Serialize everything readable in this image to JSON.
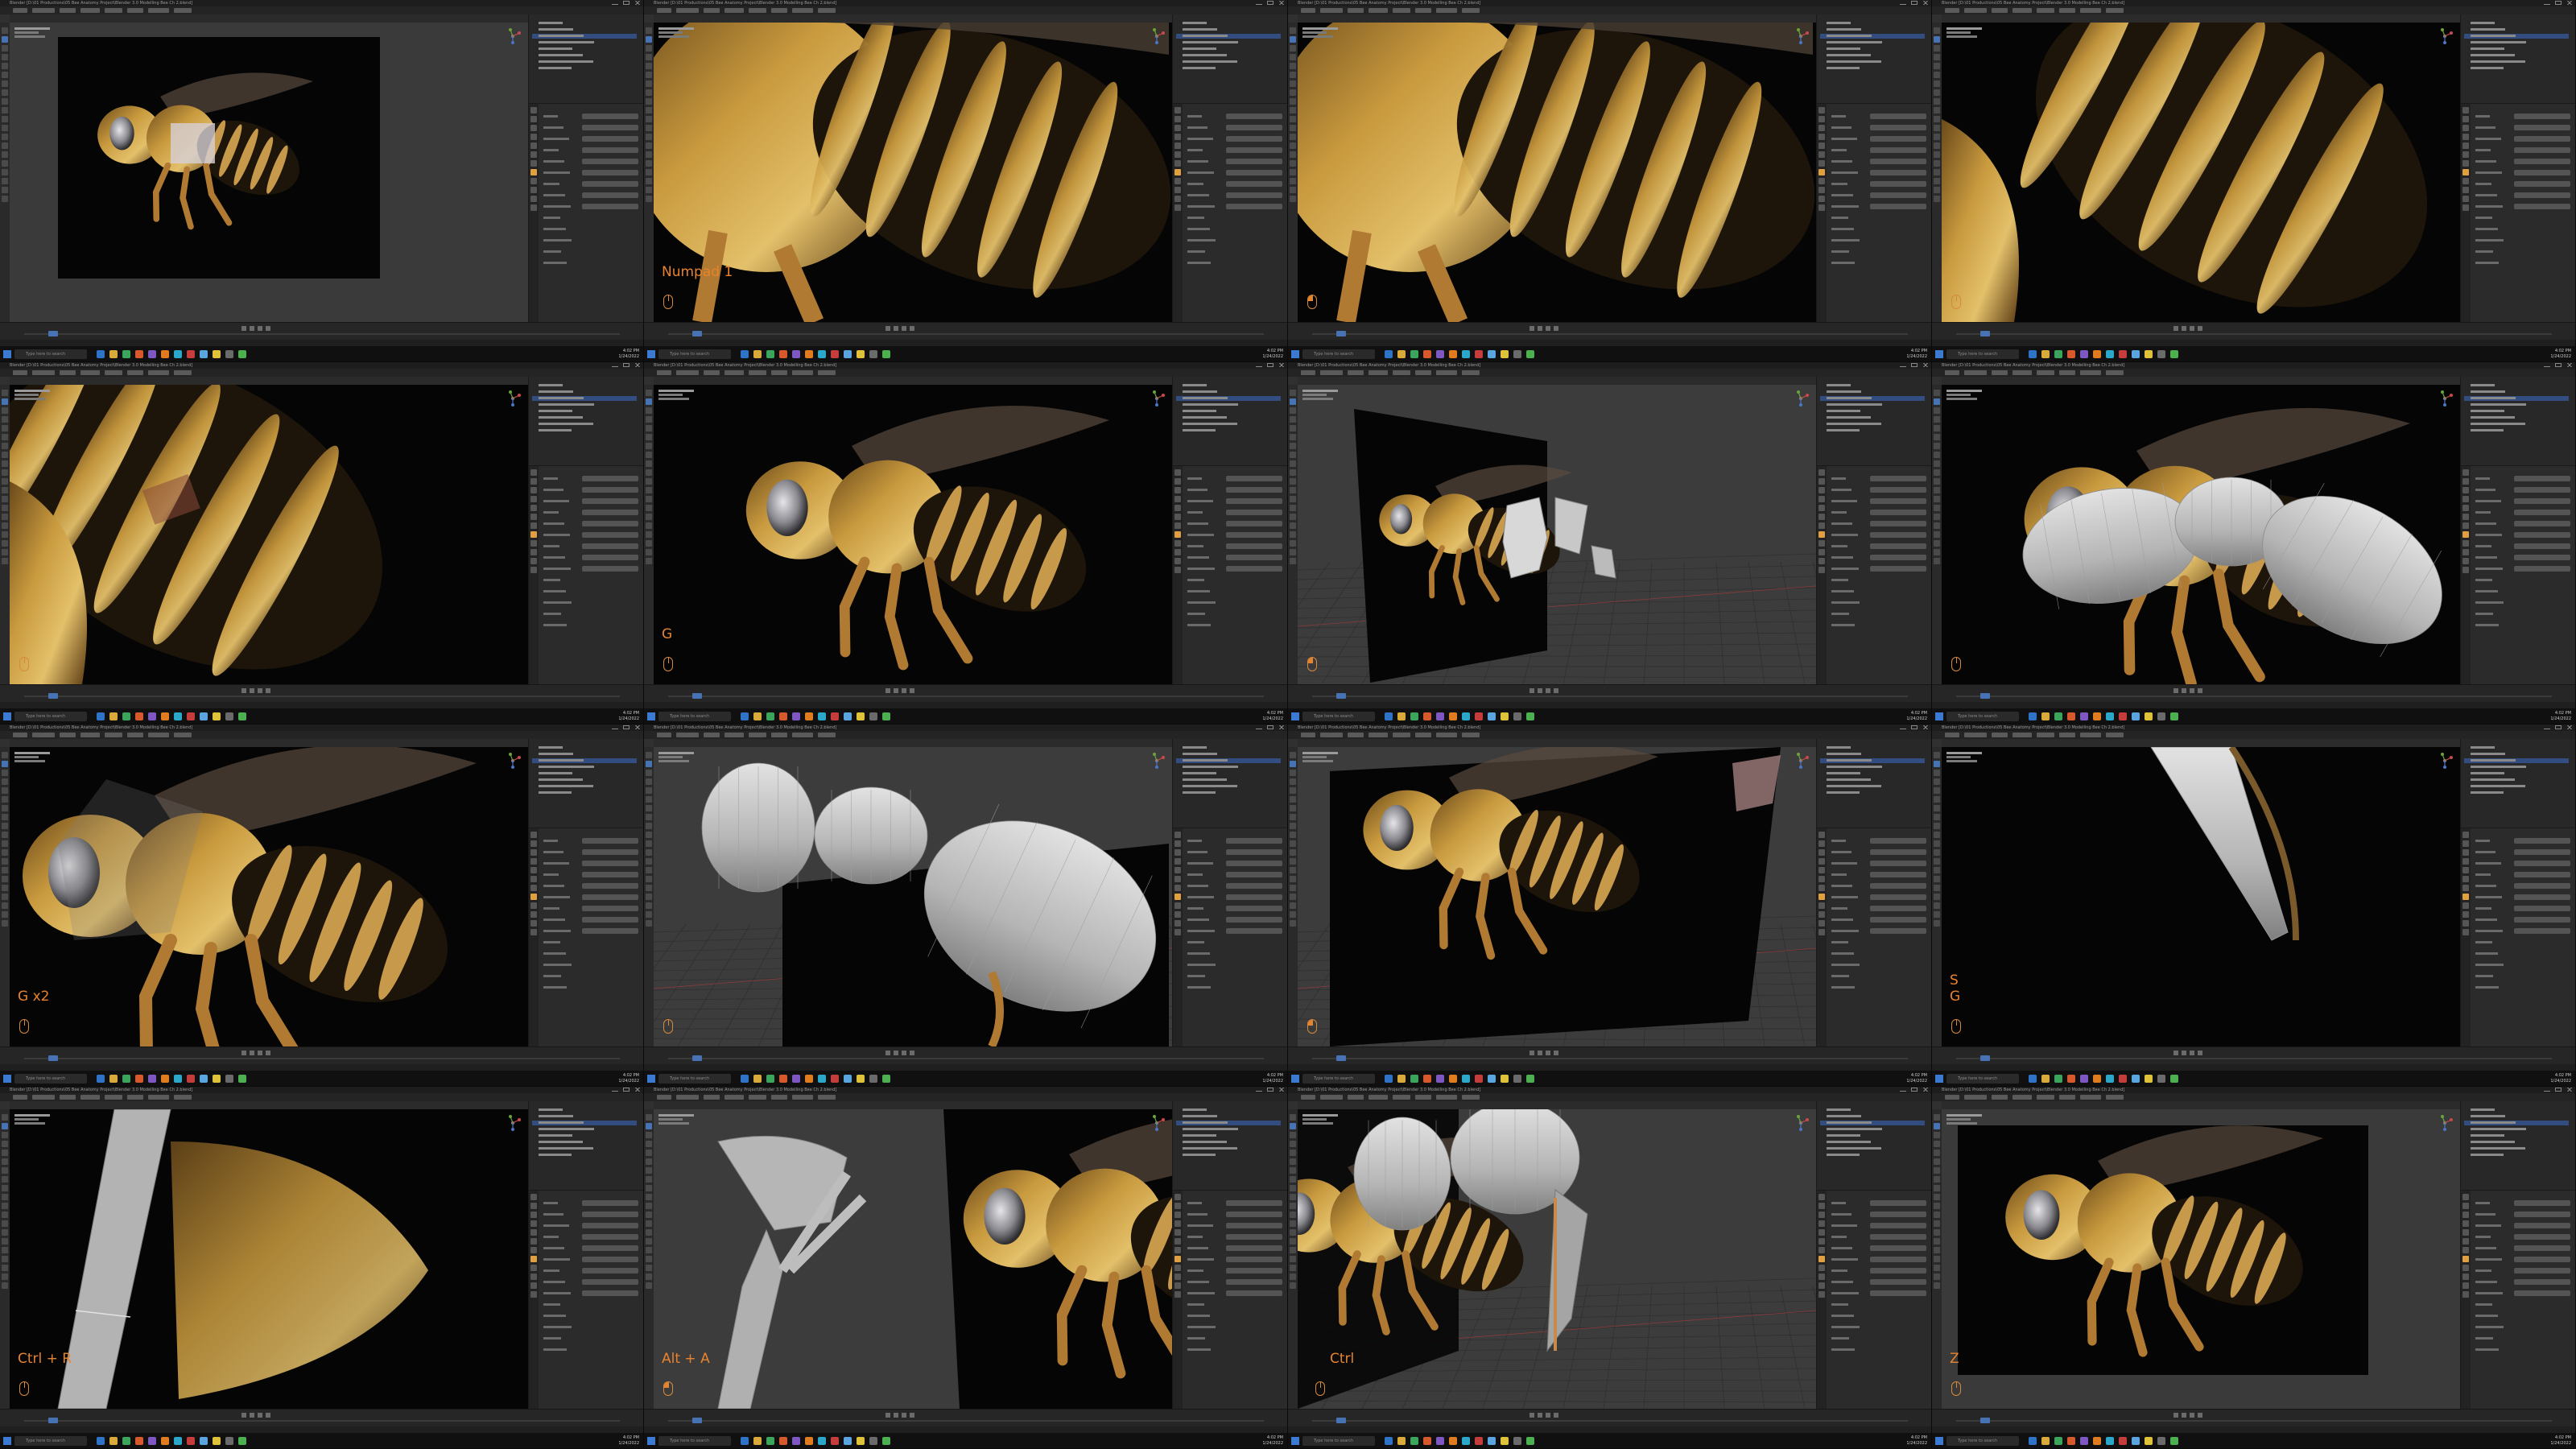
{
  "app": {
    "window_title": "Blender [D:\\01 Productions\\05 Bee Anatomy Project\\Blender 3.0 Modelling Bee Ch 2.blend]",
    "search_placeholder": "Type here to search",
    "clock_time": "4:02 PM",
    "clock_date": "1/24/2022"
  },
  "colors": {
    "viewport_bg": "#3a3a3a",
    "photo_bg": "#050505",
    "accent": "#4772b3",
    "key_label": "#e8832e",
    "mesh": "#bdbdbd"
  },
  "panels": [
    {
      "id": 1,
      "key_label": "",
      "mouse": "none",
      "scene": "photo-frame"
    },
    {
      "id": 2,
      "key_label": "Numpad 1",
      "mouse": "middle",
      "scene": "bee-thorax-closeup"
    },
    {
      "id": 3,
      "key_label": "",
      "mouse": "lmb",
      "scene": "bee-thorax-closeup-2"
    },
    {
      "id": 4,
      "key_label": "",
      "mouse": "middle",
      "scene": "bee-abdomen-closeup"
    },
    {
      "id": 5,
      "key_label": "",
      "mouse": "middle",
      "scene": "bee-abdomen-stripes"
    },
    {
      "id": 6,
      "key_label": "G",
      "mouse": "middle",
      "scene": "bee-side"
    },
    {
      "id": 7,
      "key_label": "",
      "mouse": "lmb",
      "scene": "perspective-plane-blocks"
    },
    {
      "id": 8,
      "key_label": "",
      "mouse": "middle",
      "scene": "bee-mesh-body"
    },
    {
      "id": 9,
      "key_label": "G x2",
      "mouse": "middle",
      "scene": "bee-head-closeup"
    },
    {
      "id": 10,
      "key_label": "",
      "mouse": "middle",
      "scene": "mesh-body-perspective"
    },
    {
      "id": 11,
      "key_label": "",
      "mouse": "lmb",
      "scene": "bee-plane-perspective"
    },
    {
      "id": 12,
      "key_label": "S\nG",
      "mouse": "middle",
      "scene": "bee-leg-mesh"
    },
    {
      "id": 13,
      "key_label": "Ctrl + R",
      "mouse": "middle",
      "scene": "leg-loop-cut"
    },
    {
      "id": 14,
      "key_label": "Alt + A",
      "mouse": "lmb",
      "scene": "leg-mesh-fork"
    },
    {
      "id": 15,
      "key_label": "Ctrl",
      "mouse": "middle",
      "scene": "bee-mesh-legs-3d"
    },
    {
      "id": 16,
      "key_label": "Z",
      "mouse": "middle",
      "scene": "bee-frame-front"
    }
  ]
}
